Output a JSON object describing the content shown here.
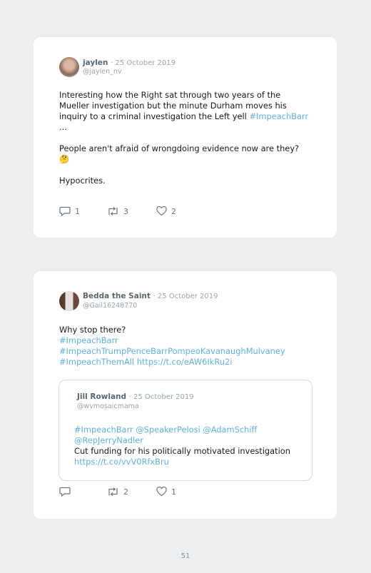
{
  "tweets": [
    {
      "name": "jaylen",
      "date": "· 25 October 2019",
      "handle": "@jaylen_nv",
      "lines": [
        "Interesting how the Right sat through two years of the",
        "Mueller investigation but the minute Durham moves his",
        "inquiry to a criminal investigation the Left yell "
      ],
      "hashtag": "#ImpeachBarr",
      "ellipsis": "...",
      "para2": "People aren't afraid of wrongdoing evidence now are they?",
      "emoji": "🤔",
      "para3": "Hypocrites.",
      "replies": "1",
      "retweets": "3",
      "likes": "2"
    },
    {
      "name": "Bedda the Saint",
      "date": "· 25 October 2019",
      "handle": "@Gail16248770",
      "line1": "Why stop there?",
      "tag1": "#ImpeachBarr",
      "tag2": "#ImpeachTrumpPenceBarrPompeoKavanaughMulvaney",
      "tag3": "#ImpeachThemAll",
      "url": "https://t.co/eAW6IkRu2i",
      "replies": "",
      "retweets": "2",
      "likes": "1",
      "quote": {
        "name": "Jill Rowland",
        "date": "· 25 October 2019",
        "handle": "@wvmosaicmama",
        "mentions1": "#ImpeachBarr @SpeakerPelosi @AdamSchiff",
        "mentions2": "@RepJerryNadler",
        "text": "Cut funding for his politically motivated investigation",
        "url": "https://t.co/vvV0RfxBru"
      }
    }
  ],
  "page_number": "51",
  "colors": {
    "link": "#5ab4e0",
    "meta": "#9aa4ad",
    "name": "#5a6773"
  }
}
